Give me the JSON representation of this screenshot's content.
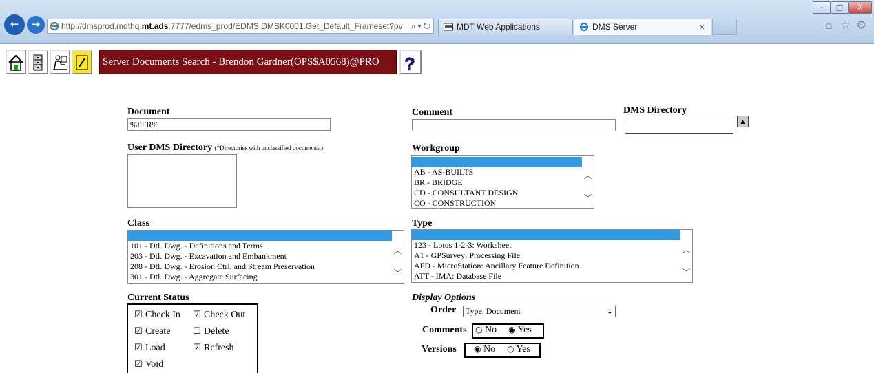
{
  "browser": {
    "address": {
      "prefix": "http://dmsprod.mdthq.",
      "host_bold": "mt.ads",
      "suffix": ":7777/edms_prod/EDMS.DMSK0001.Get_Default_Frameset?pv",
      "tools": "⌕ ▾ ↻"
    },
    "tabs": [
      {
        "label": "MDT Web Applications"
      },
      {
        "label": "DMS Server",
        "close": "×"
      }
    ],
    "window_buttons": {
      "minimize": "–",
      "maximize": "□",
      "close": "X"
    },
    "nav": {
      "back": "←",
      "forward": "→"
    },
    "icons": {
      "home": "⌂",
      "favorites": "☆",
      "tools": "⚙"
    }
  },
  "toolbar": {
    "banner": "Server Documents Search -  Brendon Gardner(OPS$A0568)@PRO",
    "help": "?"
  },
  "form": {
    "document": {
      "label": "Document",
      "value": "%PFR%"
    },
    "comment": {
      "label": "Comment",
      "value": ""
    },
    "dms_directory": {
      "label": "DMS Directory",
      "value": ""
    },
    "user_dms_directory": {
      "label": "User DMS Directory",
      "note": "(*Directories with unclassified documents.)"
    },
    "workgroup": {
      "label": "Workgroup",
      "options": [
        "",
        "AB - AS-BUILTS",
        "BR - BRIDGE",
        "CD - CONSULTANT DESIGN",
        "CO - CONSTRUCTION"
      ]
    },
    "class": {
      "label": "Class",
      "options": [
        "",
        "101 - Dtl. Dwg. - Definitions and Terms",
        "203 - Dtl. Dwg. - Excavation and Embankment",
        "208 - Dtl. Dwg. - Erosion Ctrl. and Stream Preservation",
        "301 - Dtl. Dwg. - Aggregate Surfacing"
      ]
    },
    "type": {
      "label": "Type",
      "options": [
        "",
        "123 - Lotus 1-2-3: Worksheet",
        "A1 - GPSurvey: Processing File",
        "AFD - MicroStation: Ancillary Feature Definition",
        "ATT - IMA: Database File"
      ]
    },
    "current_status": {
      "label": "Current Status",
      "items": [
        {
          "label": "Check In",
          "checked": true
        },
        {
          "label": "Check Out",
          "checked": true
        },
        {
          "label": "Create",
          "checked": true
        },
        {
          "label": "Delete",
          "checked": false
        },
        {
          "label": "Load",
          "checked": true
        },
        {
          "label": "Refresh",
          "checked": true
        },
        {
          "label": "Void",
          "checked": true
        }
      ]
    },
    "display_options": {
      "label": "Display Options",
      "order": {
        "label": "Order",
        "value": "Type, Document"
      },
      "comments": {
        "label": "Comments",
        "no": "No",
        "yes": "Yes",
        "selected": "Yes"
      },
      "versions": {
        "label": "Versions",
        "no": "No",
        "yes": "Yes",
        "selected": "No"
      }
    }
  }
}
